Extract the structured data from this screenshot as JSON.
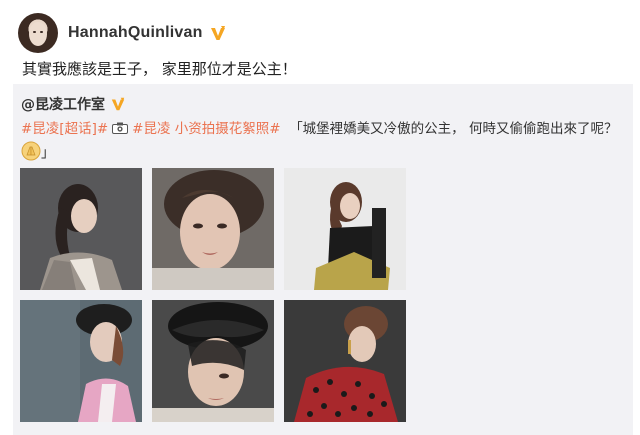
{
  "post": {
    "username": "HannahQuinlivan",
    "text": "其實我應該是王子， 家里那位才是公主！",
    "verified_badge_color": "#f5a623"
  },
  "repost": {
    "author": "@昆凌工作室",
    "tags": [
      "#昆凌[超话]#",
      "#昆凌 小资拍摄花絮照#"
    ],
    "quote": "「城堡裡嬌美又冷傲的公主， 何時又偷偷跑出來了呢？",
    "quote_end": "」",
    "emoji_name": "hands-emoji",
    "camera_icon": "camera-icon",
    "photos": [
      {
        "name": "photo-1",
        "alt": "woman in plaid blazer"
      },
      {
        "name": "photo-2",
        "alt": "close-up face with messy hair"
      },
      {
        "name": "photo-3",
        "alt": "woman in black top with yellow skirt"
      },
      {
        "name": "photo-4",
        "alt": "profile with black hat and pink top"
      },
      {
        "name": "photo-5",
        "alt": "close-up with black hat over eye"
      },
      {
        "name": "photo-6",
        "alt": "woman in red polka dot top"
      }
    ]
  },
  "colors": {
    "tag": "#eb7350",
    "repost_bg": "#f2f2f5",
    "text": "#333333"
  }
}
